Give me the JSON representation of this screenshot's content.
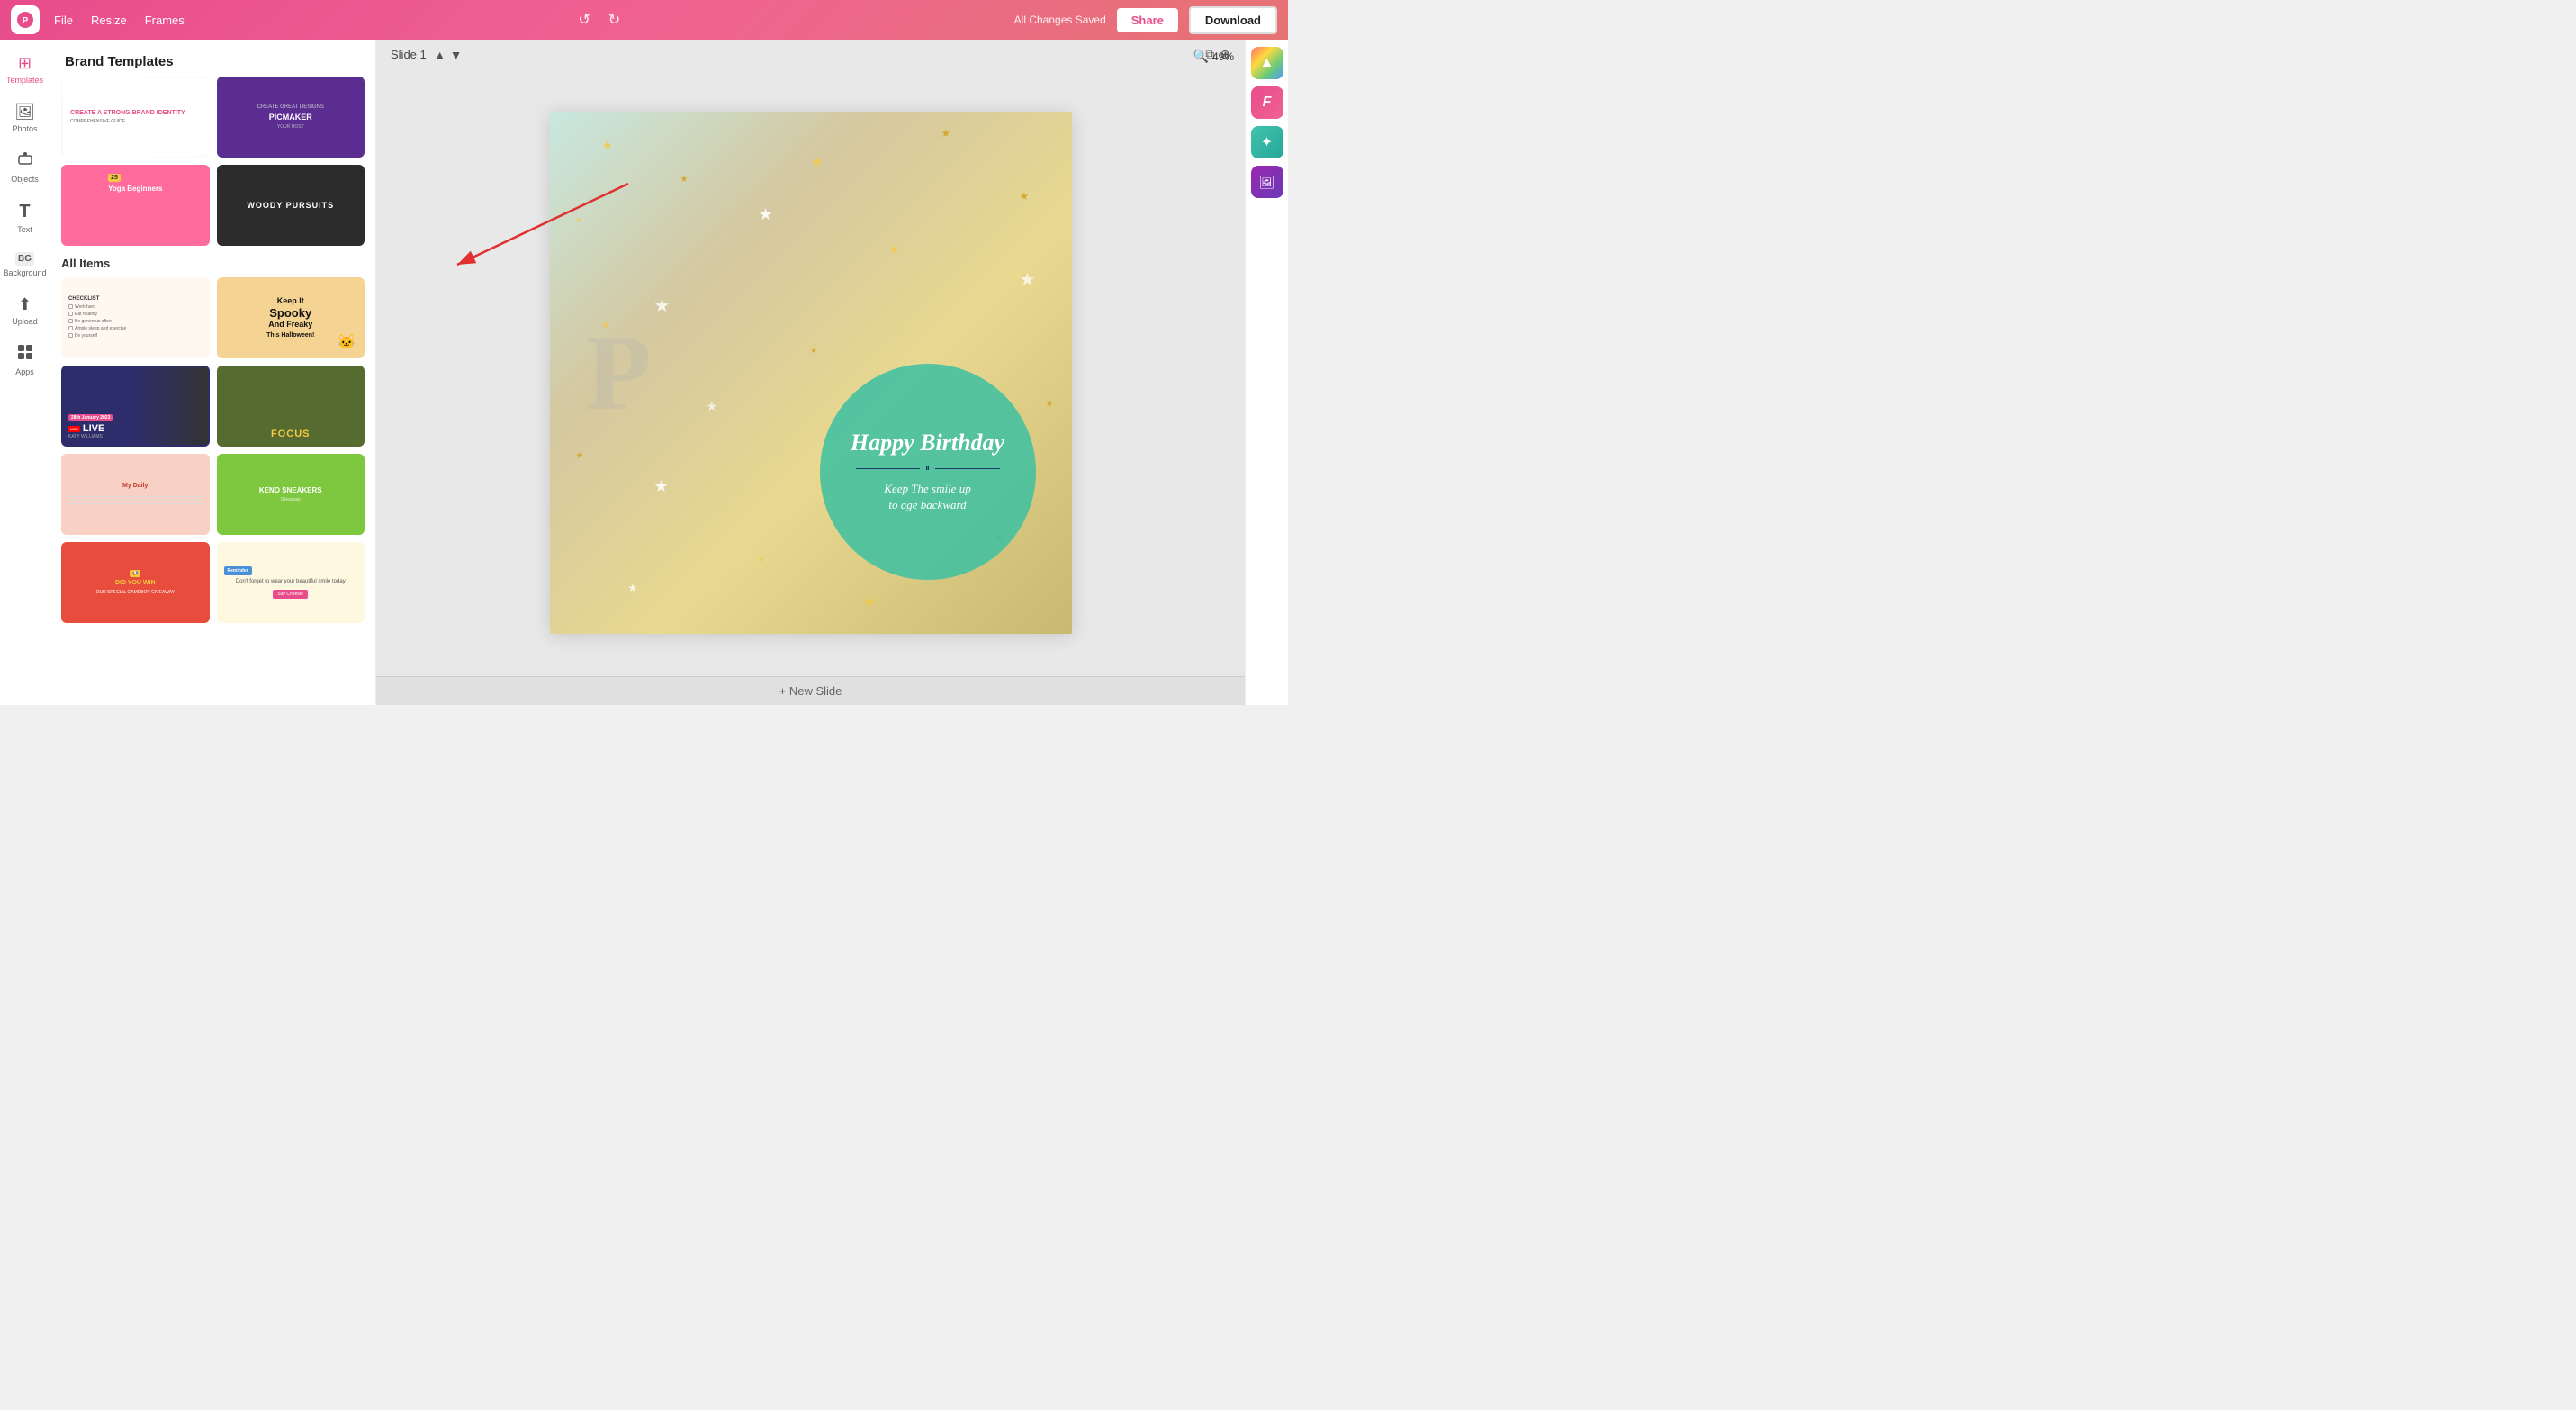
{
  "topbar": {
    "file_label": "File",
    "resize_label": "Resize",
    "frames_label": "Frames",
    "saved_text": "All Changes Saved",
    "share_label": "Share",
    "download_label": "Download"
  },
  "sidebar": {
    "items": [
      {
        "id": "templates",
        "label": "Templates",
        "icon": "⊞",
        "active": true
      },
      {
        "id": "photos",
        "label": "Photos",
        "icon": "🖼",
        "active": false
      },
      {
        "id": "objects",
        "label": "Objects",
        "icon": "☕",
        "active": false
      },
      {
        "id": "text",
        "label": "Text",
        "icon": "T",
        "active": false
      },
      {
        "id": "background",
        "label": "Background",
        "icon": "BG",
        "active": false
      },
      {
        "id": "upload",
        "label": "Upload",
        "icon": "⬆",
        "active": false
      },
      {
        "id": "apps",
        "label": "Apps",
        "icon": "⊞",
        "active": false
      }
    ]
  },
  "templates_panel": {
    "header": "Brand Templates",
    "all_items_header": "All Items"
  },
  "slide": {
    "title": "Slide 1",
    "new_slide_label": "+ New Slide"
  },
  "zoom": {
    "level": "49%"
  },
  "canvas": {
    "birthday_title": "Happy Birthday",
    "birthday_subtitle": "Keep The smile up\nto age backward",
    "p_letter": "P"
  },
  "template_thumbnails": {
    "brand_1_title": "CREATE A STRONG BRAND IDENTITY",
    "brand_2_title": "PICMAKER",
    "yoga_title": "Yoga\nBeginners",
    "woody_title": "WOODY PURSUITS",
    "checklist_title": "CHECKLIST",
    "spooky_line1": "Keep It",
    "spooky_line2": "Spooky",
    "spooky_line3": "And Freaky",
    "spooky_line4": "This Halloween!",
    "live_badge": "28th January 2023",
    "live_title": "LIVE",
    "live_name": "KATY WILLIAMS",
    "focus_text": "FOCUS",
    "daily_title": "My Daily",
    "keno_title": "KENO SNEAKERS",
    "keno_sub": "Giveaway",
    "win_text": "DID YOU WIN",
    "win_sub": "OUR SPECIAL\nGAMEBOY GIVEAWAY",
    "reminder_text": "Don't forget to wear\nyour beautiful smile today",
    "reminder_btn": "Say Cheese!"
  }
}
